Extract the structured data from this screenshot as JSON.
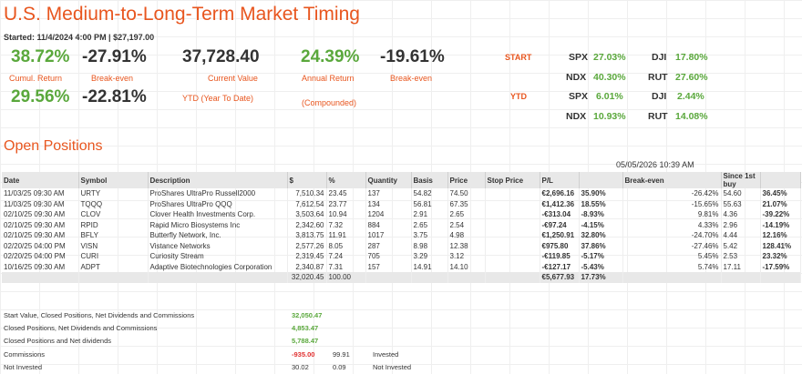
{
  "header": {
    "title": "U.S. Medium-to-Long-Term Market Timing",
    "started": "Started: 11/4/2024 4:00 PM | $27,197.00"
  },
  "stats": {
    "cumul_return_value": "38.72%",
    "cumul_return_label": "Cumul. Return",
    "breakeven1_value": "-27.91%",
    "breakeven1_label": "Break-even",
    "current_value": "37,728.40",
    "current_value_label": "Current Value",
    "annual_return_value": "24.39%",
    "annual_return_label": "Annual Return",
    "annual_return_sub": "(Compounded)",
    "breakeven2_value": "-19.61%",
    "breakeven2_label": "Break-even",
    "ytd_value": "29.56%",
    "ytd_breakeven_value": "-22.81%",
    "ytd_label": "YTD (Year To Date)"
  },
  "markets": {
    "start_label": "START",
    "ytd_label": "YTD",
    "start": [
      {
        "name": "SPX",
        "value": "27.03%"
      },
      {
        "name": "DJI",
        "value": "17.80%"
      },
      {
        "name": "NDX",
        "value": "40.30%"
      },
      {
        "name": "RUT",
        "value": "27.60%"
      }
    ],
    "ytd": [
      {
        "name": "SPX",
        "value": "6.01%"
      },
      {
        "name": "DJI",
        "value": "2.44%"
      },
      {
        "name": "NDX",
        "value": "10.93%"
      },
      {
        "name": "RUT",
        "value": "14.08%"
      }
    ]
  },
  "positions": {
    "section_title": "Open Positions",
    "timestamp": "05/05/2026 10:39 AM",
    "headers": [
      "Date",
      "Symbol",
      "Description",
      "$",
      "%",
      "Quantity",
      "Basis",
      "Price",
      "Stop Price",
      "P/L",
      "",
      "Break-even",
      "Since 1st buy",
      ""
    ],
    "rows": [
      {
        "date": "11/03/25 09:30 AM",
        "symbol": "URTY",
        "desc": "ProShares UltraPro Russell2000",
        "amount": "7,510.34",
        "pct": "23.45",
        "qty": "137",
        "basis": "54.82",
        "price": "74.50",
        "stop": "",
        "pl": "€2,696.16",
        "plpct": "35.90%",
        "be": "-26.42%",
        "first": "54.60",
        "firstpct": "36.45%",
        "pos": true,
        "fpos": true
      },
      {
        "date": "11/03/25 09:30 AM",
        "symbol": "TQQQ",
        "desc": "ProShares UltraPro QQQ",
        "amount": "7,612.54",
        "pct": "23.77",
        "qty": "134",
        "basis": "56.81",
        "price": "67.35",
        "stop": "",
        "pl": "€1,412.36",
        "plpct": "18.55%",
        "be": "-15.65%",
        "first": "55.63",
        "firstpct": "21.07%",
        "pos": true,
        "fpos": true
      },
      {
        "date": "02/10/25 09:30 AM",
        "symbol": "CLOV",
        "desc": "Clover Health Investments Corp.",
        "amount": "3,503.64",
        "pct": "10.94",
        "qty": "1204",
        "basis": "2.91",
        "price": "2.65",
        "stop": "",
        "pl": "-€313.04",
        "plpct": "-8.93%",
        "be": "9.81%",
        "first": "4.36",
        "firstpct": "-39.22%",
        "pos": false,
        "fpos": false
      },
      {
        "date": "02/10/25 09:30 AM",
        "symbol": "RPID",
        "desc": "Rapid Micro Biosystems Inc",
        "amount": "2,342.60",
        "pct": "7.32",
        "qty": "884",
        "basis": "2.65",
        "price": "2.54",
        "stop": "",
        "pl": "-€97.24",
        "plpct": "-4.15%",
        "be": "4.33%",
        "first": "2.96",
        "firstpct": "-14.19%",
        "pos": false,
        "fpos": false
      },
      {
        "date": "02/10/25 09:30 AM",
        "symbol": "BFLY",
        "desc": "Butterfly Network, Inc.",
        "amount": "3,813.75",
        "pct": "11.91",
        "qty": "1017",
        "basis": "3.75",
        "price": "4.98",
        "stop": "",
        "pl": "€1,250.91",
        "plpct": "32.80%",
        "be": "-24.70%",
        "first": "4.44",
        "firstpct": "12.16%",
        "pos": true,
        "fpos": true
      },
      {
        "date": "02/20/25 04:00 PM",
        "symbol": "VISN",
        "desc": "Vistance Networks",
        "amount": "2,577.26",
        "pct": "8.05",
        "qty": "287",
        "basis": "8.98",
        "price": "12.38",
        "stop": "",
        "pl": "€975.80",
        "plpct": "37.86%",
        "be": "-27.46%",
        "first": "5.42",
        "firstpct": "128.41%",
        "pos": true,
        "fpos": true
      },
      {
        "date": "02/20/25 04:00 PM",
        "symbol": "CURI",
        "desc": "Curiosity Stream",
        "amount": "2,319.45",
        "pct": "7.24",
        "qty": "705",
        "basis": "3.29",
        "price": "3.12",
        "stop": "",
        "pl": "-€119.85",
        "plpct": "-5.17%",
        "be": "5.45%",
        "first": "2.53",
        "firstpct": "23.32%",
        "pos": false,
        "fpos": true
      },
      {
        "date": "10/16/25 09:30 AM",
        "symbol": "ADPT",
        "desc": "Adaptive Biotechnologies Corporation",
        "amount": "2,340.87",
        "pct": "7.31",
        "qty": "157",
        "basis": "14.91",
        "price": "14.10",
        "stop": "",
        "pl": "-€127.17",
        "plpct": "-5.43%",
        "be": "5.74%",
        "first": "17.11",
        "firstpct": "-17.59%",
        "pos": false,
        "fpos": false
      }
    ],
    "totals": {
      "amount": "32,020.45",
      "pct": "100.00",
      "pl": "€5,677.93",
      "plpct": "17.73%"
    }
  },
  "summary": {
    "start_value_label": "Start Value, Closed Positions, Net Dividends and Commissions",
    "start_value": "32,050.47",
    "closed_label": "Closed Positions, Net Dividends and Commissions",
    "closed_value": "4,853.47",
    "closed_nd_label": "Closed Positions and Net dividends",
    "closed_nd_value": "5,788.47",
    "commissions_label": "Commissions",
    "commissions_value": "-935.00",
    "commissions_pct": "99.91",
    "commissions_note": "Invested",
    "not_invested_label": "Not Invested",
    "not_invested_value": "30.02",
    "not_invested_pct": "0.09",
    "not_invested_note": "Not Invested"
  },
  "colors": {
    "accent": "#e8561f",
    "positive": "#5aa83c",
    "negative": "#e03030"
  }
}
